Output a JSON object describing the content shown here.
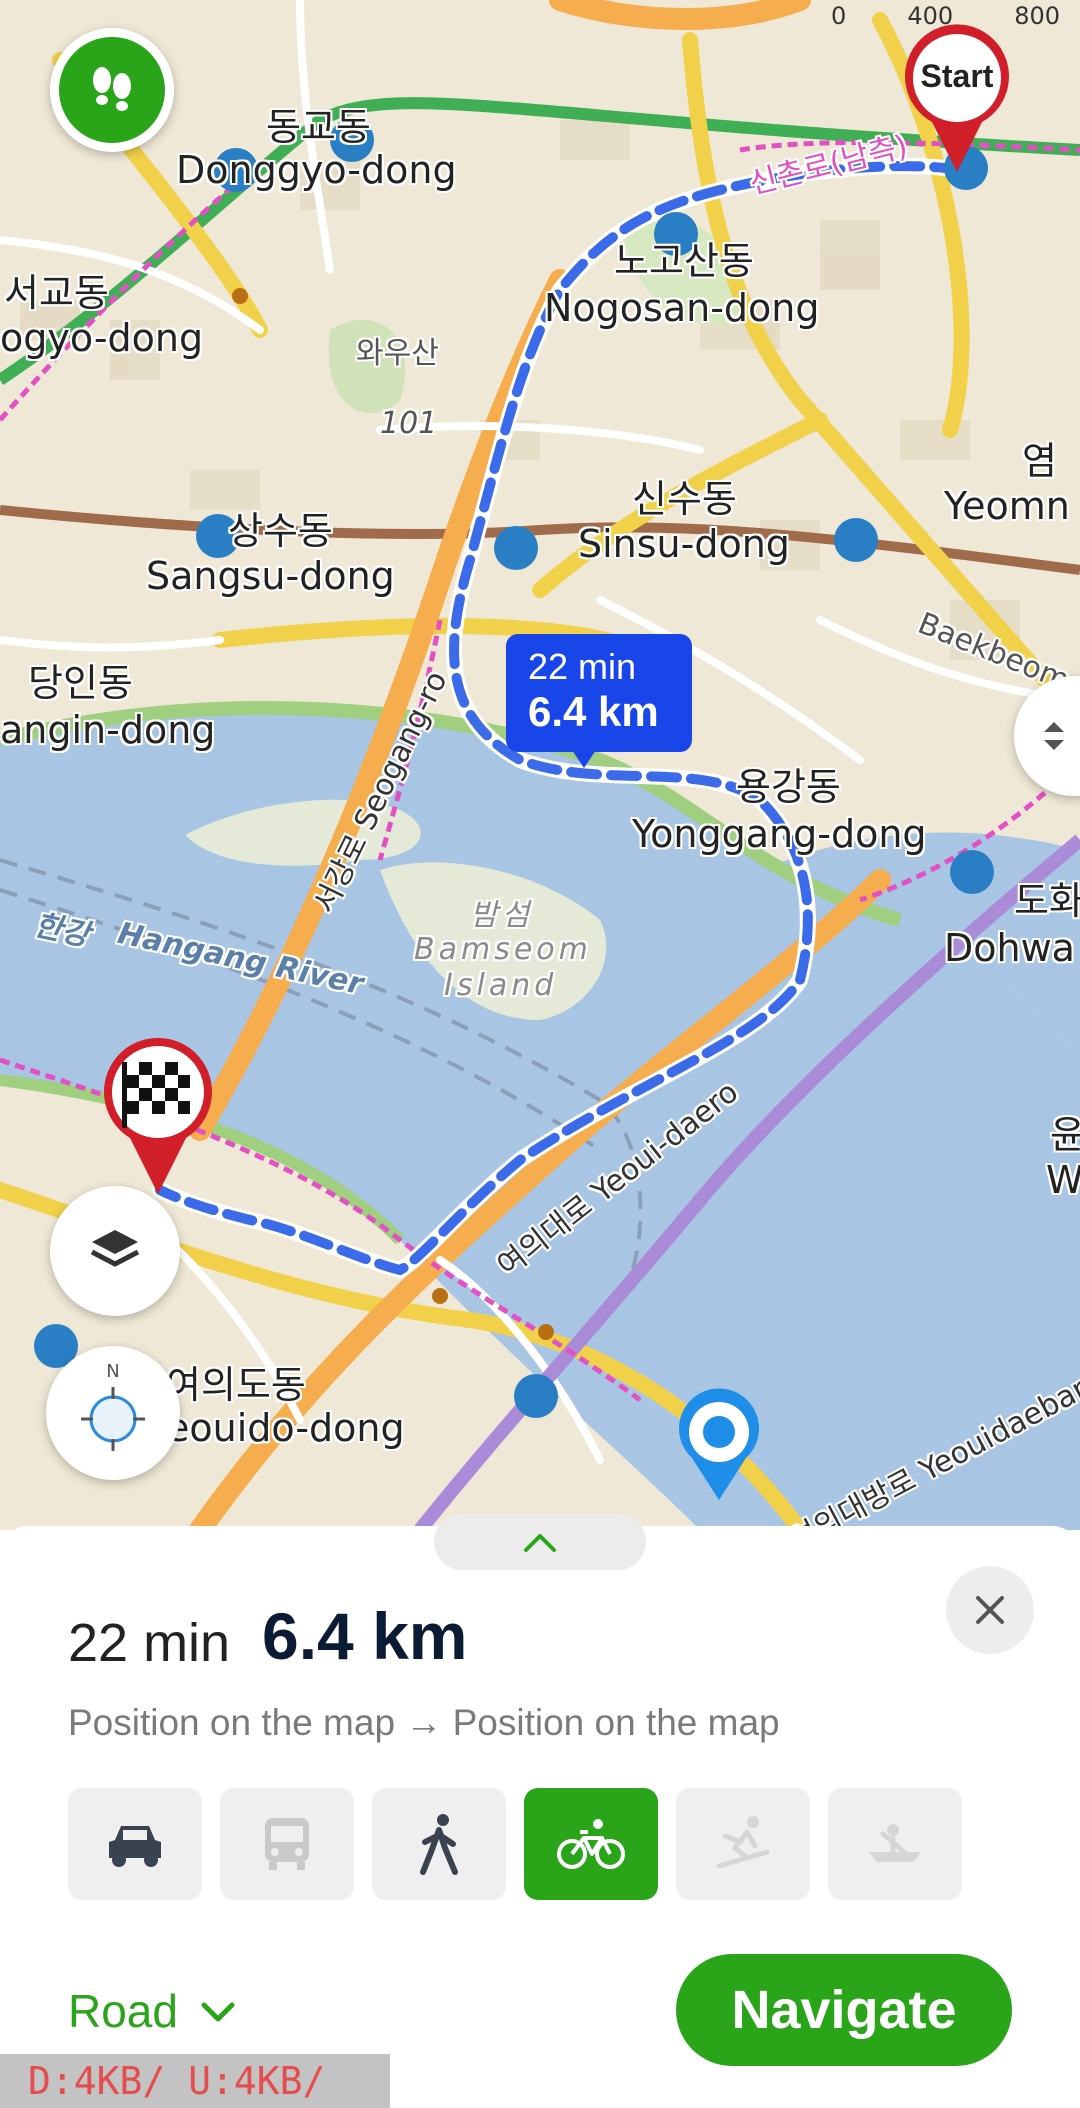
{
  "map": {
    "scale_labels": [
      "0",
      "400",
      "800"
    ],
    "start_label": "Start",
    "route_bubble": {
      "time": "22 min",
      "distance": "6.4 km"
    },
    "labels": {
      "donggyo_kr": "동교동",
      "donggyo_en": "Donggyo-dong",
      "seogyo_kr": "서교동",
      "seogyo_en": "ogyo-dong",
      "nogosan_kr": "노고산동",
      "nogosan_en": "Nogosan-dong",
      "wausan": "와우산",
      "peak": "101",
      "sinsu_kr": "신수동",
      "sinsu_en": "Sinsu-dong",
      "sangsu_kr": "상수동",
      "sangsu_en": "Sangsu-dong",
      "dangin_kr": "당인동",
      "dangin_en": "angin-dong",
      "yeom_kr": "염",
      "yeom_en": "Yeomn",
      "baekbeom": "Baekbeom-",
      "yonggang_kr": "용강동",
      "yonggang_en": "Yonggang-dong",
      "dohwa_kr": "도화",
      "dohwa_en": "Dohwa",
      "hangang_kr": "한강",
      "hangang_en": "Hangang River",
      "bamseom_kr": "밤섬",
      "bamseom_en1": "Bamseom",
      "bamseom_en2": "Island",
      "seogang": "서강로 Seogang-ro",
      "yeouidaero": "여의대로 Yeoui-daero",
      "yeouido_kr": "여의도동",
      "yeouido_en": "eouido-dong",
      "yeouidaebang": "여의대방로 Yeouidaebang",
      "sinchon_road": "신촌로(남측)",
      "w_label": "W",
      "yun": "윤"
    }
  },
  "sheet": {
    "time": "22 min",
    "distance": "6.4 km",
    "route_text": "Position on the map → Position on the map",
    "modes": [
      {
        "name": "car",
        "active": false
      },
      {
        "name": "transit",
        "active": false,
        "disabled": true
      },
      {
        "name": "walk",
        "active": false
      },
      {
        "name": "bicycle",
        "active": true
      },
      {
        "name": "ski",
        "active": false,
        "disabled": true
      },
      {
        "name": "boat",
        "active": false,
        "disabled": true
      }
    ],
    "road_option": "Road",
    "navigate_label": "Navigate"
  },
  "debug": {
    "text": "D:4KB/ U:4KB/"
  },
  "colors": {
    "accent": "#2aa51a",
    "route": "#1946e8",
    "water": "#a9c5e4"
  }
}
